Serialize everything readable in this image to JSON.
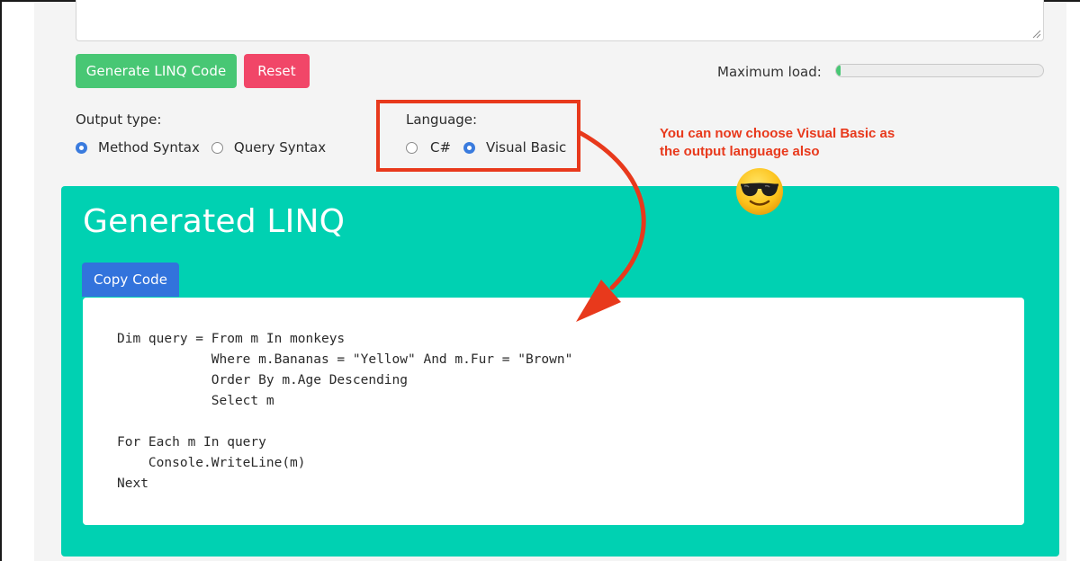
{
  "controls": {
    "generate_label": "Generate LINQ Code",
    "reset_label": "Reset",
    "max_load_label": "Maximum load:",
    "max_load_progress": 0.01
  },
  "output_type": {
    "label": "Output type:",
    "options": [
      "Method Syntax",
      "Query Syntax"
    ],
    "selected": "Method Syntax"
  },
  "language": {
    "label": "Language:",
    "options": [
      "C#",
      "Visual Basic"
    ],
    "selected": "Visual Basic"
  },
  "annotation": {
    "line1": "You can now choose Visual Basic as",
    "line2": "the output language also"
  },
  "result": {
    "title": "Generated LINQ",
    "copy_label": "Copy Code",
    "code_lines": [
      "Dim query = From m In monkeys",
      "            Where m.Bananas = \"Yellow\" And m.Fur = \"Brown\"",
      "            Order By m.Age Descending",
      "            Select m",
      "",
      "For Each m In query",
      "    Console.WriteLine(m)",
      "Next"
    ]
  },
  "colors": {
    "success": "#48c774",
    "danger": "#f14668",
    "primary": "#3273dc",
    "panel": "#00d1b2",
    "annotation": "#e8391c",
    "radio_checked": "#3a7bde"
  },
  "icons": {
    "emoji": "smiling-face-with-sunglasses-icon",
    "arrow": "curved-arrow-icon",
    "resize": "resize-grip-icon"
  }
}
